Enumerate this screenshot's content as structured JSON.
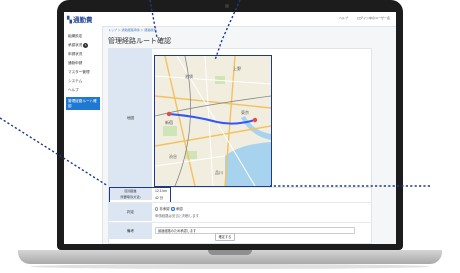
{
  "app": {
    "logo_text": "通勤費",
    "help_label": "ヘルプ",
    "user_label": "ログイン中のユーザー名"
  },
  "breadcrumb": "トップ ＞ 通勤経路申請 ＞ 経路確認",
  "page_title": "管理経路ルート確認",
  "sidebar": {
    "items": [
      {
        "label": "組織設定"
      },
      {
        "label": "承認状況",
        "badge": "1"
      },
      {
        "label": "申請状況"
      },
      {
        "label": "通勤申請"
      },
      {
        "label": "マスター管理"
      },
      {
        "label": "システム"
      },
      {
        "label": "ヘルプ"
      },
      {
        "label": "管理経路ルート確認",
        "active": true
      }
    ]
  },
  "form": {
    "map_label": "地図",
    "distance_label": "区間距離",
    "distance_value": "12.1 km",
    "time_label": "所要時間(片道)",
    "time_value": "42 分",
    "judgement_label": "判定",
    "radio_option_1": "非承認",
    "radio_option_2": "承認",
    "judgement_note": "申請経路は妥当と判断します",
    "comment_label": "備考",
    "comment_value": "最適経路のため承認します",
    "submit_label": "確定する"
  },
  "map": {
    "stations": [
      "池袋",
      "新宿",
      "渋谷",
      "東京",
      "品川",
      "上野"
    ]
  }
}
